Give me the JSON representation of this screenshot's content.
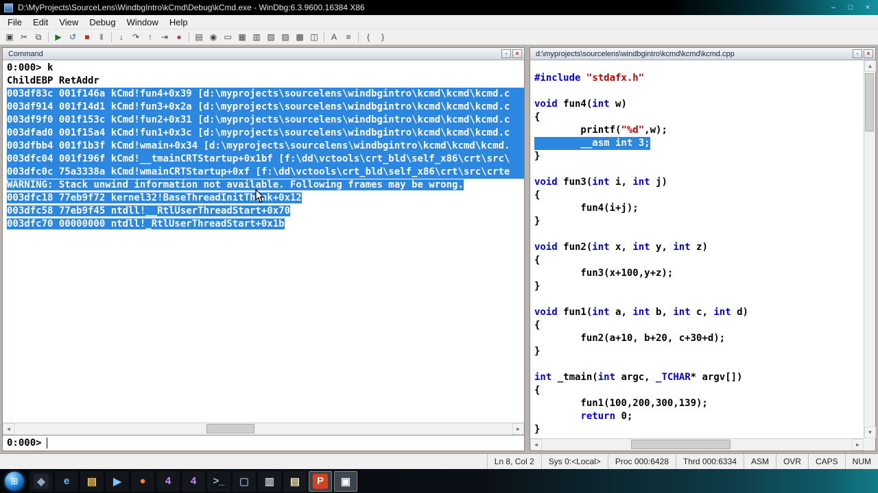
{
  "colors": {
    "selection": "#2b87e0",
    "keyword": "#0000e6",
    "string": "#c00000"
  },
  "window": {
    "title": "D:\\MyProjects\\SourceLens\\WindbgIntro\\kCmd\\Debug\\kCmd.exe - WinDbg:6.3.9600.16384 X86",
    "minimize": "–",
    "maximize": "□",
    "close": "×"
  },
  "menu": {
    "items": [
      "File",
      "Edit",
      "View",
      "Debug",
      "Window",
      "Help"
    ]
  },
  "toolbar": {
    "icons": [
      {
        "name": "open-source-file",
        "glyph": "▣"
      },
      {
        "name": "cut",
        "glyph": "✂"
      },
      {
        "name": "copy",
        "glyph": "⧉"
      },
      {
        "sep": true
      },
      {
        "name": "go",
        "glyph": "▶",
        "fg": "#1a7a1a"
      },
      {
        "name": "restart",
        "glyph": "↺",
        "fg": "#2a5fb0"
      },
      {
        "name": "stop-debugging",
        "glyph": "■",
        "fg": "#b03030"
      },
      {
        "name": "break",
        "glyph": "‖"
      },
      {
        "sep": true
      },
      {
        "name": "step-into",
        "glyph": "↓"
      },
      {
        "name": "step-over",
        "glyph": "↷"
      },
      {
        "name": "step-out",
        "glyph": "↑"
      },
      {
        "name": "run-to-cursor",
        "glyph": "⇥"
      },
      {
        "name": "insert-breakpoint",
        "glyph": "●",
        "fg": "#c03030"
      },
      {
        "sep": true
      },
      {
        "name": "command-window",
        "glyph": "▤"
      },
      {
        "name": "watch-window",
        "glyph": "◉"
      },
      {
        "name": "locals-window",
        "glyph": "▭"
      },
      {
        "name": "registers-window",
        "glyph": "▦"
      },
      {
        "name": "memory-window",
        "glyph": "▥"
      },
      {
        "name": "call-stack-window",
        "glyph": "▧"
      },
      {
        "name": "disassembly-window",
        "glyph": "▨"
      },
      {
        "name": "scratch-pad",
        "glyph": "▩"
      },
      {
        "name": "processes-window",
        "glyph": "◫"
      },
      {
        "sep": true
      },
      {
        "name": "font",
        "glyph": "A"
      },
      {
        "name": "options",
        "glyph": "≡"
      },
      {
        "sep": true
      },
      {
        "name": "source-mode-on",
        "glyph": "{"
      },
      {
        "name": "source-mode-off",
        "glyph": "}"
      }
    ]
  },
  "command": {
    "title": "Command",
    "prompt": "0:000>",
    "lines": [
      {
        "text": "0:000> k",
        "hl": "none"
      },
      {
        "text": "ChildEBP RetAddr",
        "hl": "none"
      },
      {
        "text": "003df83c 001f146a kCmd!fun4+0x39 [d:\\myprojects\\sourcelens\\windbgintro\\kcmd\\kcmd\\kcmd.c",
        "hl": "full"
      },
      {
        "text": "003df914 001f14d1 kCmd!fun3+0x2a [d:\\myprojects\\sourcelens\\windbgintro\\kcmd\\kcmd\\kcmd.c",
        "hl": "full"
      },
      {
        "text": "003df9f0 001f153c kCmd!fun2+0x31 [d:\\myprojects\\sourcelens\\windbgintro\\kcmd\\kcmd\\kcmd.c",
        "hl": "full"
      },
      {
        "text": "003dfad0 001f15a4 kCmd!fun1+0x3c [d:\\myprojects\\sourcelens\\windbgintro\\kcmd\\kcmd\\kcmd.c",
        "hl": "full"
      },
      {
        "text": "003dfbb4 001f1b3f kCmd!wmain+0x34 [d:\\myprojects\\sourcelens\\windbgintro\\kcmd\\kcmd\\kcmd.",
        "hl": "full"
      },
      {
        "text": "003dfc04 001f196f kCmd!__tmainCRTStartup+0x1bf [f:\\dd\\vctools\\crt_bld\\self_x86\\crt\\src\\",
        "hl": "full"
      },
      {
        "text": "003dfc0c 75a3338a kCmd!wmainCRTStartup+0xf [f:\\dd\\vctools\\crt_bld\\self_x86\\crt\\src\\crte",
        "hl": "full"
      },
      {
        "text": "WARNING: Stack unwind information not available. Following frames may be wrong.",
        "hl": "inline"
      },
      {
        "text": "003dfc18 77eb9f72 kernel32!BaseThreadInitThunk+0x12",
        "hl": "inline"
      },
      {
        "text": "003dfc58 77eb9f45 ntdll!__RtlUserThreadStart+0x70",
        "hl": "inline"
      },
      {
        "text": "003dfc70 00000000 ntdll!_RtlUserThreadStart+0x1b",
        "hl": "inline"
      }
    ]
  },
  "source": {
    "title": "d:\\myprojects\\sourcelens\\windbgintro\\kcmd\\kcmd\\kcmd.cpp",
    "lines": [
      {
        "hl": false,
        "seg": [
          [
            "k",
            "#include "
          ],
          [
            "s",
            "\"stdafx.h\""
          ]
        ]
      },
      {
        "hl": false,
        "seg": []
      },
      {
        "hl": false,
        "seg": [
          [
            "k",
            "void"
          ],
          [
            "p",
            " fun4("
          ],
          [
            "k",
            "int"
          ],
          [
            "p",
            " w)"
          ]
        ]
      },
      {
        "hl": false,
        "seg": [
          [
            "p",
            "{"
          ]
        ]
      },
      {
        "hl": false,
        "seg": [
          [
            "p",
            "        printf("
          ],
          [
            "s",
            "\"%d\""
          ],
          [
            "p",
            ",w);"
          ]
        ]
      },
      {
        "hl": true,
        "seg": [
          [
            "p",
            "        __asm int 3;"
          ]
        ]
      },
      {
        "hl": false,
        "seg": [
          [
            "p",
            "}"
          ]
        ]
      },
      {
        "hl": false,
        "seg": []
      },
      {
        "hl": false,
        "seg": [
          [
            "k",
            "void"
          ],
          [
            "p",
            " fun3("
          ],
          [
            "k",
            "int"
          ],
          [
            "p",
            " i, "
          ],
          [
            "k",
            "int"
          ],
          [
            "p",
            " j)"
          ]
        ]
      },
      {
        "hl": false,
        "seg": [
          [
            "p",
            "{"
          ]
        ]
      },
      {
        "hl": false,
        "seg": [
          [
            "p",
            "        fun4(i+j);"
          ]
        ]
      },
      {
        "hl": false,
        "seg": [
          [
            "p",
            "}"
          ]
        ]
      },
      {
        "hl": false,
        "seg": []
      },
      {
        "hl": false,
        "seg": [
          [
            "k",
            "void"
          ],
          [
            "p",
            " fun2("
          ],
          [
            "k",
            "int"
          ],
          [
            "p",
            " x, "
          ],
          [
            "k",
            "int"
          ],
          [
            "p",
            " y, "
          ],
          [
            "k",
            "int"
          ],
          [
            "p",
            " z)"
          ]
        ]
      },
      {
        "hl": false,
        "seg": [
          [
            "p",
            "{"
          ]
        ]
      },
      {
        "hl": false,
        "seg": [
          [
            "p",
            "        fun3(x+100,y+z);"
          ]
        ]
      },
      {
        "hl": false,
        "seg": [
          [
            "p",
            "}"
          ]
        ]
      },
      {
        "hl": false,
        "seg": []
      },
      {
        "hl": false,
        "seg": [
          [
            "k",
            "void"
          ],
          [
            "p",
            " fun1("
          ],
          [
            "k",
            "int"
          ],
          [
            "p",
            " a, "
          ],
          [
            "k",
            "int"
          ],
          [
            "p",
            " b, "
          ],
          [
            "k",
            "int"
          ],
          [
            "p",
            " c, "
          ],
          [
            "k",
            "int"
          ],
          [
            "p",
            " d)"
          ]
        ]
      },
      {
        "hl": false,
        "seg": [
          [
            "p",
            "{"
          ]
        ]
      },
      {
        "hl": false,
        "seg": [
          [
            "p",
            "        fun2(a+10, b+20, c+30+d);"
          ]
        ]
      },
      {
        "hl": false,
        "seg": [
          [
            "p",
            "}"
          ]
        ]
      },
      {
        "hl": false,
        "seg": []
      },
      {
        "hl": false,
        "seg": [
          [
            "k",
            "int"
          ],
          [
            "p",
            " _tmain("
          ],
          [
            "k",
            "int"
          ],
          [
            "p",
            " argc, "
          ],
          [
            "k",
            "_TCHAR"
          ],
          [
            "p",
            "* argv[])"
          ]
        ]
      },
      {
        "hl": false,
        "seg": [
          [
            "p",
            "{"
          ]
        ]
      },
      {
        "hl": false,
        "seg": [
          [
            "p",
            "        fun1(100,200,300,139);"
          ]
        ]
      },
      {
        "hl": false,
        "seg": [
          [
            "p",
            "        "
          ],
          [
            "k",
            "return"
          ],
          [
            "p",
            " 0;"
          ]
        ]
      },
      {
        "hl": false,
        "seg": [
          [
            "p",
            "}"
          ]
        ]
      }
    ]
  },
  "status": {
    "fields": [
      "Ln 8, Col 2",
      "Sys 0:<Local>",
      "Proc 000:6428",
      "Thrd 000:6334",
      "ASM",
      "OVR",
      "CAPS",
      "NUM"
    ]
  },
  "taskbar": {
    "start_glyph": "⊞",
    "icons": [
      {
        "name": "taskbar-item-app1",
        "glyph": "◆",
        "fg": "#8fa6c4",
        "bg": "#20242e"
      },
      {
        "name": "taskbar-item-internet-explorer",
        "glyph": "e",
        "fg": "#5cc3ff"
      },
      {
        "name": "taskbar-item-explorer-folder",
        "glyph": "▤",
        "fg": "#f2c14e"
      },
      {
        "name": "taskbar-item-media-player",
        "glyph": "▶",
        "fg": "#7fc3ff"
      },
      {
        "name": "taskbar-item-app-orange",
        "glyph": "●",
        "fg": "#ff7a3d"
      },
      {
        "name": "taskbar-item-app-four-1",
        "glyph": "4",
        "fg": "#c58cff"
      },
      {
        "name": "taskbar-item-app-four-2",
        "glyph": "4",
        "fg": "#c58cff"
      },
      {
        "name": "taskbar-item-console",
        "glyph": ">_",
        "fg": "#9fb7d4",
        "bg": "#11151c"
      },
      {
        "name": "taskbar-item-app-blue",
        "glyph": "▢",
        "fg": "#88a0c0"
      },
      {
        "name": "taskbar-item-app-gray",
        "glyph": "▥",
        "fg": "#c0c8d4"
      },
      {
        "name": "taskbar-item-notepad",
        "glyph": "▤",
        "fg": "#efe6b0"
      },
      {
        "name": "taskbar-item-powerpoint",
        "glyph": "P",
        "fg": "#ffffff",
        "bg": "#d04423",
        "active": true
      },
      {
        "name": "taskbar-item-document-window",
        "glyph": "▣",
        "fg": "#ffffff",
        "bg": "#3a4756",
        "active": true
      }
    ]
  }
}
